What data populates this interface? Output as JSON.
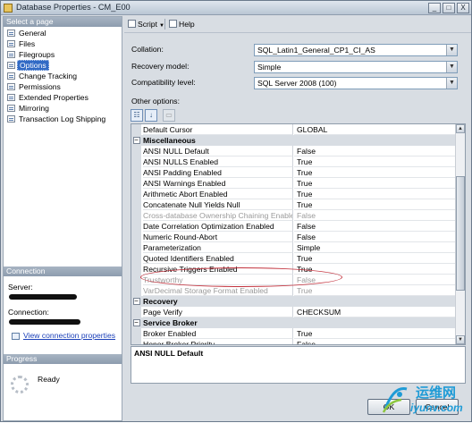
{
  "window": {
    "title": "Database Properties - CM_E00",
    "controls": {
      "minimize": "_",
      "maximize": "□",
      "close": "X"
    }
  },
  "sidebar": {
    "header": "Select a page",
    "items": [
      {
        "label": "General",
        "selected": false
      },
      {
        "label": "Files",
        "selected": false
      },
      {
        "label": "Filegroups",
        "selected": false
      },
      {
        "label": "Options",
        "selected": true
      },
      {
        "label": "Change Tracking",
        "selected": false
      },
      {
        "label": "Permissions",
        "selected": false
      },
      {
        "label": "Extended Properties",
        "selected": false
      },
      {
        "label": "Mirroring",
        "selected": false
      },
      {
        "label": "Transaction Log Shipping",
        "selected": false
      }
    ]
  },
  "connection": {
    "header": "Connection",
    "server_label": "Server:",
    "connection_label": "Connection:",
    "view_link": "View connection properties"
  },
  "progress": {
    "header": "Progress",
    "status": "Ready"
  },
  "toolbar": {
    "script_label": "Script",
    "help_label": "Help"
  },
  "form": {
    "collation": {
      "label": "Collation:",
      "value": "SQL_Latin1_General_CP1_CI_AS"
    },
    "recovery_model": {
      "label": "Recovery model:",
      "value": "Simple"
    },
    "compatibility": {
      "label": "Compatibility level:",
      "value": "SQL Server 2008 (100)"
    },
    "other_options_label": "Other options:"
  },
  "grid_toolbar": {
    "categorized_icon": "categorized-icon",
    "alphabetical_icon": "alphabetical-icon",
    "property_pages_icon": "property-pages-icon"
  },
  "grid": {
    "rows": [
      {
        "kind": "property",
        "name": "Default Cursor",
        "value": "GLOBAL",
        "disabled": false
      },
      {
        "kind": "category",
        "name": "Miscellaneous",
        "toggle": "−"
      },
      {
        "kind": "property",
        "name": "ANSI NULL Default",
        "value": "False",
        "disabled": false
      },
      {
        "kind": "property",
        "name": "ANSI NULLS Enabled",
        "value": "True",
        "disabled": false
      },
      {
        "kind": "property",
        "name": "ANSI Padding Enabled",
        "value": "True",
        "disabled": false
      },
      {
        "kind": "property",
        "name": "ANSI Warnings Enabled",
        "value": "True",
        "disabled": false
      },
      {
        "kind": "property",
        "name": "Arithmetic Abort Enabled",
        "value": "True",
        "disabled": false
      },
      {
        "kind": "property",
        "name": "Concatenate Null Yields Null",
        "value": "True",
        "disabled": false
      },
      {
        "kind": "property",
        "name": "Cross-database Ownership Chaining Enabled",
        "value": "False",
        "disabled": true
      },
      {
        "kind": "property",
        "name": "Date Correlation Optimization Enabled",
        "value": "False",
        "disabled": false
      },
      {
        "kind": "property",
        "name": "Numeric Round-Abort",
        "value": "False",
        "disabled": false
      },
      {
        "kind": "property",
        "name": "Parameterization",
        "value": "Simple",
        "disabled": false
      },
      {
        "kind": "property",
        "name": "Quoted Identifiers Enabled",
        "value": "True",
        "disabled": false
      },
      {
        "kind": "property",
        "name": "Recursive Triggers Enabled",
        "value": "True",
        "disabled": false
      },
      {
        "kind": "property",
        "name": "Trustworthy",
        "value": "False",
        "disabled": true
      },
      {
        "kind": "property",
        "name": "VarDecimal Storage Format Enabled",
        "value": "True",
        "disabled": true
      },
      {
        "kind": "category",
        "name": "Recovery",
        "toggle": "−"
      },
      {
        "kind": "property",
        "name": "Page Verify",
        "value": "CHECKSUM",
        "disabled": false
      },
      {
        "kind": "category",
        "name": "Service Broker",
        "toggle": "−"
      },
      {
        "kind": "property",
        "name": "Broker Enabled",
        "value": "True",
        "disabled": false
      },
      {
        "kind": "property",
        "name": "Honor Broker Priority",
        "value": "False",
        "disabled": false
      }
    ],
    "highlight_color": "#c2313c"
  },
  "description": {
    "title": "ANSI NULL Default"
  },
  "buttons": {
    "ok": "OK",
    "cancel": "Cancel"
  },
  "watermark": {
    "text_cn": "运维网",
    "url": "iyunv.com"
  }
}
